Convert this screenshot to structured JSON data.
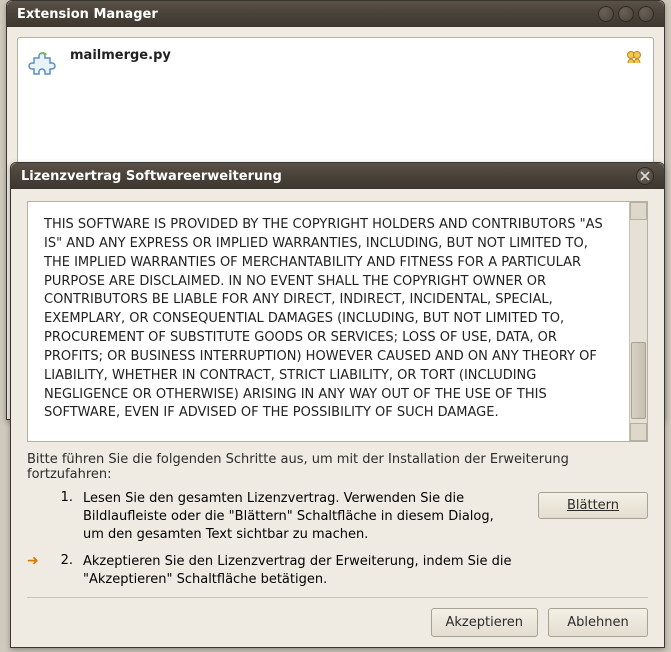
{
  "extension_manager": {
    "title": "Extension Manager",
    "item": {
      "name": "mailmerge.py"
    }
  },
  "license_dialog": {
    "title": "Lizenzvertrag Softwareerweiterung",
    "license_text": "THIS SOFTWARE IS PROVIDED BY THE COPYRIGHT HOLDERS AND CONTRIBUTORS \"AS IS\" AND ANY EXPRESS OR IMPLIED WARRANTIES, INCLUDING, BUT NOT LIMITED TO, THE IMPLIED WARRANTIES OF MERCHANTABILITY AND FITNESS FOR A PARTICULAR PURPOSE ARE DISCLAIMED. IN NO EVENT SHALL THE COPYRIGHT OWNER OR CONTRIBUTORS BE LIABLE FOR ANY DIRECT, INDIRECT, INCIDENTAL, SPECIAL, EXEMPLARY, OR CONSEQUENTIAL DAMAGES (INCLUDING, BUT NOT LIMITED TO, PROCUREMENT OF SUBSTITUTE GOODS OR SERVICES; LOSS OF USE, DATA, OR PROFITS; OR BUSINESS INTERRUPTION) HOWEVER CAUSED AND ON ANY THEORY OF LIABILITY, WHETHER IN CONTRACT, STRICT LIABILITY, OR TORT (INCLUDING NEGLIGENCE OR OTHERWISE) ARISING IN ANY WAY OUT OF THE USE OF THIS SOFTWARE, EVEN IF ADVISED OF THE POSSIBILITY OF SUCH DAMAGE.",
    "instruction": "Bitte führen Sie die folgenden Schritte aus, um mit der Installation der Erweiterung fortzufahren:",
    "steps": [
      {
        "num": "1.",
        "text": "Lesen Sie den gesamten Lizenzvertrag. Verwenden Sie die Bildlaufleiste oder die \"Blättern\" Schaltfläche in diesem Dialog, um den gesamten Text sichtbar zu machen."
      },
      {
        "num": "2.",
        "text": "Akzeptieren Sie den Lizenzvertrag der Erweiterung, indem Sie die \"Akzeptieren\" Schaltfläche betätigen."
      }
    ],
    "scroll_label": "Blättern",
    "accept_label": "Akzeptieren",
    "decline_label": "Ablehnen"
  }
}
